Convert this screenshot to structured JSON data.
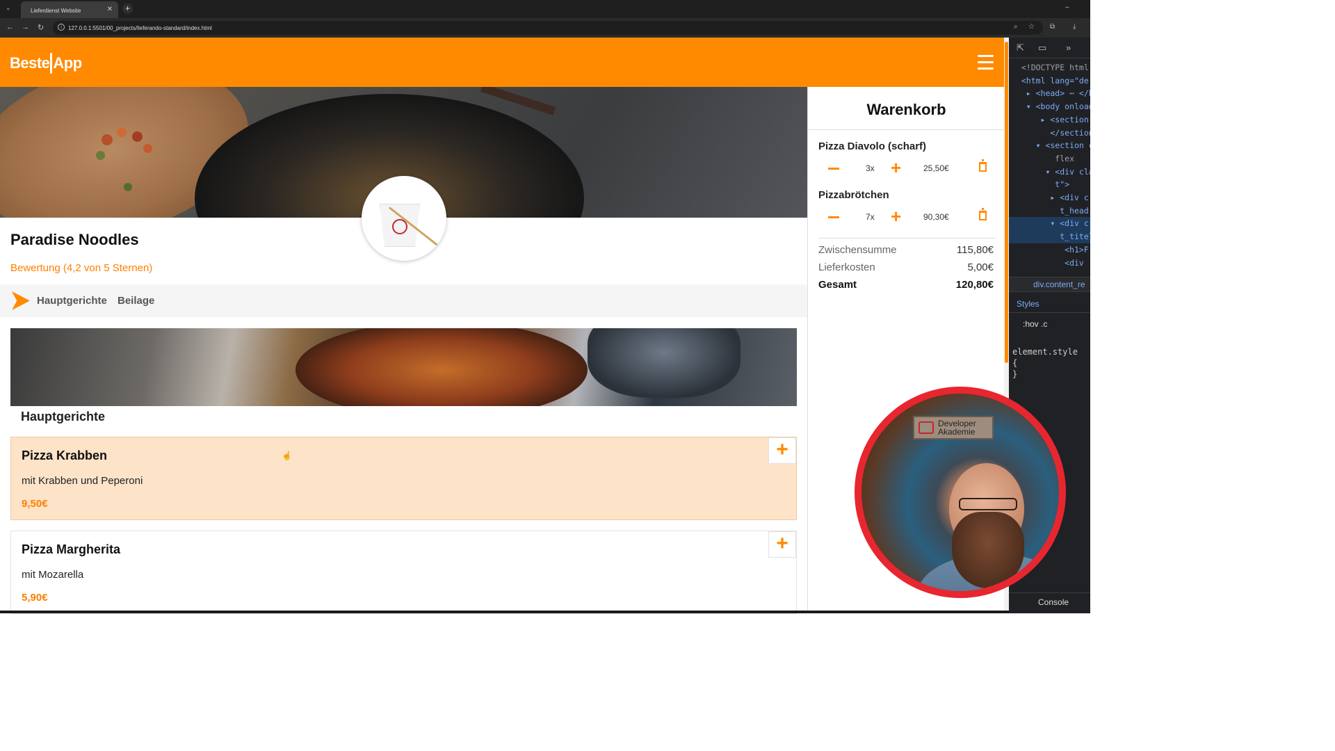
{
  "browser": {
    "tab_title": "Lieferdienst Website",
    "tab_close": "✕",
    "new_tab": "+",
    "url": "127.0.0.1:5501/00_projects/lieferando-standard/index.html"
  },
  "header": {
    "logo_left": "Beste",
    "logo_right": "App"
  },
  "restaurant": {
    "name": "Paradise Noodles",
    "rating": "Bewertung (4,2 von 5 Sternen)"
  },
  "categories": [
    "Hauptgerichte",
    "Beilage"
  ],
  "menu": {
    "section_title": "Hauptgerichte",
    "add_label": "+",
    "dishes": [
      {
        "name": "Pizza Krabben",
        "description": "mit Krabben und Peperoni",
        "price": "9,50€"
      },
      {
        "name": "Pizza Margherita",
        "description": "mit Mozarella",
        "price": "5,90€"
      }
    ]
  },
  "basket": {
    "title": "Warenkorb",
    "items": [
      {
        "name": "Pizza Diavolo (scharf)",
        "qty": "3x",
        "price": "25,50€"
      },
      {
        "name": "Pizzabrötchen",
        "qty": "7x",
        "price": "90,30€"
      }
    ],
    "subtotal_label": "Zwischensumme",
    "subtotal_value": "115,80€",
    "delivery_label": "Lieferkosten",
    "delivery_value": "5,00€",
    "total_label": "Gesamt",
    "total_value": "120,80€"
  },
  "devtools": {
    "breadcrumb": "div.content_re",
    "styles_tab": "Styles",
    "filter": ":hov  .c",
    "console_tab": "Console"
  },
  "webcam": {
    "sign_line1": "Developer",
    "sign_line2": "Akademie"
  },
  "colors": {
    "brand_orange": "#ff8a00",
    "hover_card": "#fde3c8",
    "webcam_ring": "#e8262f"
  }
}
